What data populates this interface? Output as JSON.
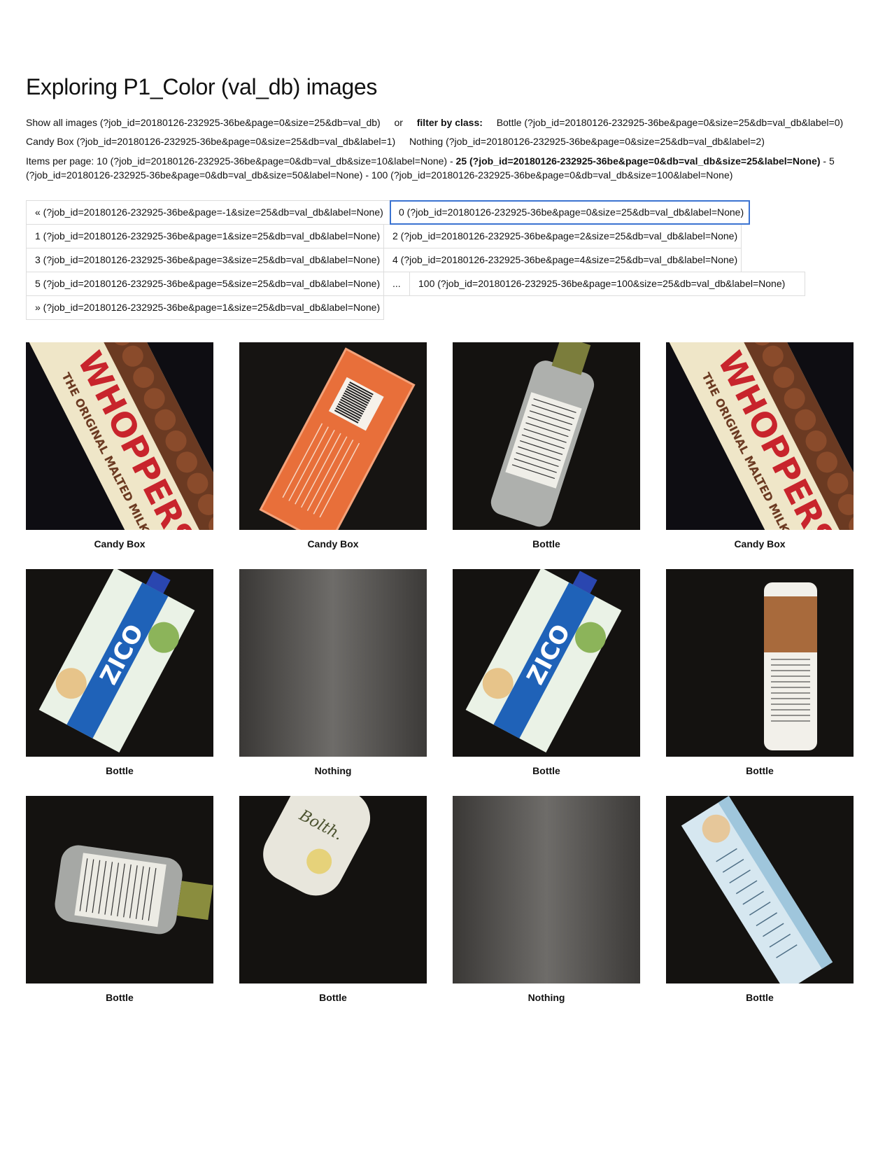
{
  "page_title": "Exploring P1_Color (val_db) images",
  "filter": {
    "show_all": "Show all images (?job_id=20180126-232925-36be&page=0&size=25&db=val_db)",
    "or": "or",
    "filter_label": "filter by class:",
    "classes": [
      "Bottle (?job_id=20180126-232925-36be&page=0&size=25&db=val_db&label=0)",
      "Candy Box (?job_id=20180126-232925-36be&page=0&size=25&db=val_db&label=1)",
      "Nothing (?job_id=20180126-232925-36be&page=0&size=25&db=val_db&label=2)"
    ]
  },
  "items_per_page": {
    "label": "Items per page:",
    "options": [
      "10 (?job_id=20180126-232925-36be&page=0&db=val_db&size=10&label=None)",
      "25 (?job_id=20180126-232925-36be&page=0&db=val_db&size=25&label=None)",
      "50 (?job_id=20180126-232925-36be&page=0&db=val_db&size=50&label=None)",
      "100 (?job_id=20180126-232925-36be&page=0&db=val_db&size=100&label=None)"
    ],
    "line1_50": "5",
    "line2_50": "(?job_id=20180126-232925-36be&page=0&db=val_db&size=50&label=None)",
    "dash": "-"
  },
  "pager": [
    "« (?job_id=20180126-232925-36be&page=-1&size=25&db=val_db&label=None)",
    "0 (?job_id=20180126-232925-36be&page=0&size=25&db=val_db&label=None)",
    "1 (?job_id=20180126-232925-36be&page=1&size=25&db=val_db&label=None)",
    "2 (?job_id=20180126-232925-36be&page=2&size=25&db=val_db&label=None)",
    "3 (?job_id=20180126-232925-36be&page=3&size=25&db=val_db&label=None)",
    "4 (?job_id=20180126-232925-36be&page=4&size=25&db=val_db&label=None)",
    "5 (?job_id=20180126-232925-36be&page=5&size=25&db=val_db&label=None)",
    "...",
    "100 (?job_id=20180126-232925-36be&page=100&size=25&db=val_db&label=None)",
    "» (?job_id=20180126-232925-36be&page=1&size=25&db=val_db&label=None)"
  ],
  "images": [
    {
      "label": "Candy Box",
      "content": "whoppers-box"
    },
    {
      "label": "Candy Box",
      "content": "orange-box"
    },
    {
      "label": "Bottle",
      "content": "clear-bottle"
    },
    {
      "label": "Candy Box",
      "content": "whoppers-box"
    },
    {
      "label": "Bottle",
      "content": "zico-carton"
    },
    {
      "label": "Nothing",
      "content": "empty-surface"
    },
    {
      "label": "Bottle",
      "content": "zico-carton"
    },
    {
      "label": "Bottle",
      "content": "milk-bottle"
    },
    {
      "label": "Bottle",
      "content": "clear-bottle-horizontal"
    },
    {
      "label": "Bottle",
      "content": "dressing-bottle"
    },
    {
      "label": "Nothing",
      "content": "empty-surface"
    },
    {
      "label": "Bottle",
      "content": "juice-carton"
    }
  ]
}
